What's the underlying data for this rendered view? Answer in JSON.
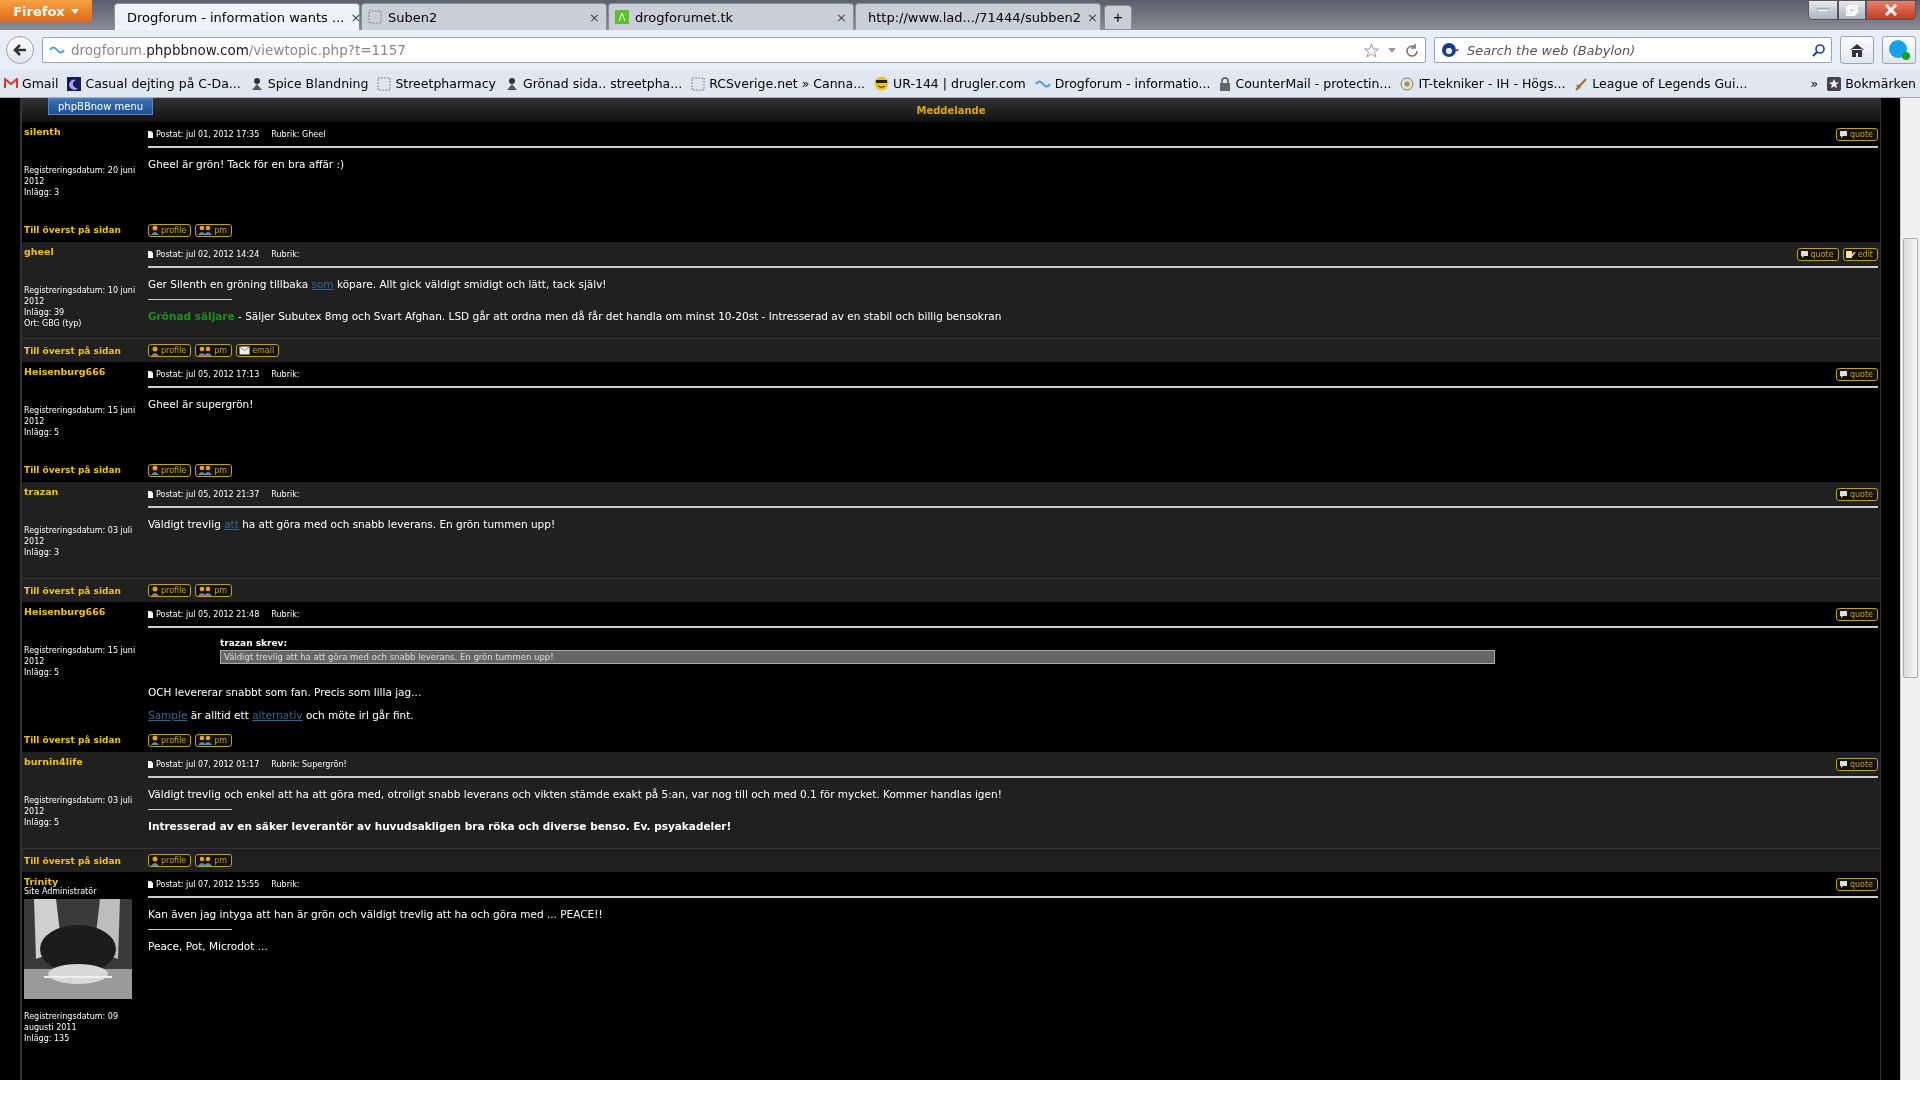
{
  "browser": {
    "menu_button": "Firefox",
    "tabs": [
      {
        "title": "Drogforum - information wants ...",
        "selected": true,
        "close": "×"
      },
      {
        "title": "Suben2",
        "selected": false,
        "close": "×"
      },
      {
        "title": "drogforumet.tk",
        "selected": false,
        "close": "×"
      },
      {
        "title": "http://www.lad.../71444/subben2",
        "selected": false,
        "close": "×"
      }
    ],
    "new_tab": "+",
    "address": {
      "prefix": "drogforum.",
      "domain": "phpbbnow.com",
      "path": "/viewtopic.php?t=1157"
    },
    "search": {
      "placeholder": "Search the web (Babylon)"
    },
    "bookmarks": [
      {
        "label": "Gmail"
      },
      {
        "label": "Casual dejting på C-Da..."
      },
      {
        "label": "Spice Blandning"
      },
      {
        "label": "Streetpharmacy"
      },
      {
        "label": "Grönad sida.. streetpha..."
      },
      {
        "label": "RCSverige.net » Canna..."
      },
      {
        "label": "UR-144 | drugler.com"
      },
      {
        "label": "Drogforum - informatio..."
      },
      {
        "label": "CounterMail - protectin..."
      },
      {
        "label": "IT-tekniker - IH - Högs..."
      },
      {
        "label": "League of Legends Gui..."
      }
    ],
    "more": "»",
    "bookmarks_menu": "Bokmärken"
  },
  "forum": {
    "menu_button": "phpBBnow menu",
    "header": "Meddelande",
    "posts": [
      {
        "author": "silenth",
        "registered": "Registreringsdatum: 20 juni 2012",
        "count": "Inlägg: 3",
        "posted": "Postat: jul 01, 2012 17:35",
        "subject": "Rubrik: Gheel",
        "to_top": "Till överst på sidan",
        "top_buttons": [
          "quote"
        ],
        "bottom_buttons": [
          "profile",
          "pm"
        ],
        "body": [
          [
            {
              "kind": "text",
              "text": "Gheel är grön! Tack för en bra affär :)"
            }
          ]
        ]
      },
      {
        "author": "gheel",
        "registered": "Registreringsdatum: 10 juni 2012",
        "count": "Inlägg: 39",
        "location": "Ort: GBG (typ)",
        "posted": "Postat: jul 02, 2012 14:24",
        "subject": "Rubrik:",
        "to_top": "Till överst på sidan",
        "top_buttons": [
          "quote",
          "edit"
        ],
        "bottom_buttons": [
          "profile",
          "pm",
          "email"
        ],
        "body": [
          [
            {
              "kind": "text",
              "text": "Ger Silenth en gröning tillbaka "
            },
            {
              "kind": "link",
              "text": "som"
            },
            {
              "kind": "text",
              "text": " köpare. Allt gick väldigt smidigt och lätt, tack själv!"
            }
          ]
        ],
        "signature": [
          [
            {
              "kind": "highlight",
              "text": "Grönad säljare"
            },
            {
              "kind": "text",
              "text": " - Säljer Subutex 8mg och Svart Afghan. LSD går att ordna men då får det handla om minst 10-20st - Intresserad av en stabil och billig bensokran"
            }
          ]
        ]
      },
      {
        "author": "Heisenburg666",
        "registered": "Registreringsdatum: 15 juni 2012",
        "count": "Inlägg: 5",
        "posted": "Postat: jul 05, 2012 17:13",
        "subject": "Rubrik:",
        "to_top": "Till överst på sidan",
        "top_buttons": [
          "quote"
        ],
        "bottom_buttons": [
          "profile",
          "pm"
        ],
        "body": [
          [
            {
              "kind": "text",
              "text": "Gheel är supergrön!"
            }
          ]
        ]
      },
      {
        "author": "trazan",
        "registered": "Registreringsdatum: 03 juli 2012",
        "count": "Inlägg: 3",
        "posted": "Postat: jul 05, 2012 21:37",
        "subject": "Rubrik:",
        "to_top": "Till överst på sidan",
        "top_buttons": [
          "quote"
        ],
        "bottom_buttons": [
          "profile",
          "pm"
        ],
        "body": [
          [
            {
              "kind": "text",
              "text": "Väldigt trevlig "
            },
            {
              "kind": "link",
              "text": "att"
            },
            {
              "kind": "text",
              "text": " ha att göra med och snabb leverans. En grön tummen upp!"
            }
          ]
        ]
      },
      {
        "author": "Heisenburg666",
        "registered": "Registreringsdatum: 15 juni 2012",
        "count": "Inlägg: 5",
        "posted": "Postat: jul 05, 2012 21:48",
        "subject": "Rubrik:",
        "to_top": "Till överst på sidan",
        "top_buttons": [
          "quote"
        ],
        "bottom_buttons": [
          "profile",
          "pm"
        ],
        "quote": {
          "author": "trazan skrev:",
          "text": "Väldigt trevlig att ha att göra med och snabb leverans. En grön tummen upp!"
        },
        "body": [
          [
            {
              "kind": "text",
              "text": "OCH levererar snabbt som fan. Precis som lilla jag..."
            }
          ],
          [
            {
              "kind": "link",
              "text": "Sample"
            },
            {
              "kind": "text",
              "text": " är alltid ett "
            },
            {
              "kind": "link",
              "text": "alternativ"
            },
            {
              "kind": "text",
              "text": " och möte irl går fint."
            }
          ]
        ]
      },
      {
        "author": "burnin4life",
        "registered": "Registreringsdatum: 03 juli 2012",
        "count": "Inlägg: 5",
        "posted": "Postat: jul 07, 2012 01:17",
        "subject": "Rubrik: Supergrön!",
        "to_top": "Till överst på sidan",
        "top_buttons": [
          "quote"
        ],
        "bottom_buttons": [
          "profile",
          "pm"
        ],
        "body": [
          [
            {
              "kind": "text",
              "text": "Väldigt trevlig och enkel att ha att göra med, otroligt snabb leverans och vikten stämde exakt på 5:an, var nog till och med 0.1 för mycket. Kommer handlas igen!"
            }
          ]
        ],
        "signature": [
          [
            {
              "kind": "bold",
              "text": "Intresserad av en säker leverantör av huvudsakligen bra röka och diverse benso. Ev. psyakadeler!"
            }
          ]
        ]
      },
      {
        "author": "Trinity",
        "rank": "Site Administratör",
        "avatar": {
          "kind": "picture"
        },
        "registered": "Registreringsdatum: 09 augusti 2011",
        "count": "Inlägg: 135",
        "posted": "Postat: jul 07, 2012 15:55",
        "subject": "Rubrik:",
        "top_buttons": [
          "quote"
        ],
        "body": [
          [
            {
              "kind": "text",
              "text": "Kan även jag intyga att han är grön och väldigt trevlig att ha och göra med ... PEACE!!"
            }
          ]
        ],
        "signature": [
          [
            {
              "kind": "text",
              "text": "Peace, Pot, Microdot ..."
            }
          ]
        ]
      }
    ]
  }
}
